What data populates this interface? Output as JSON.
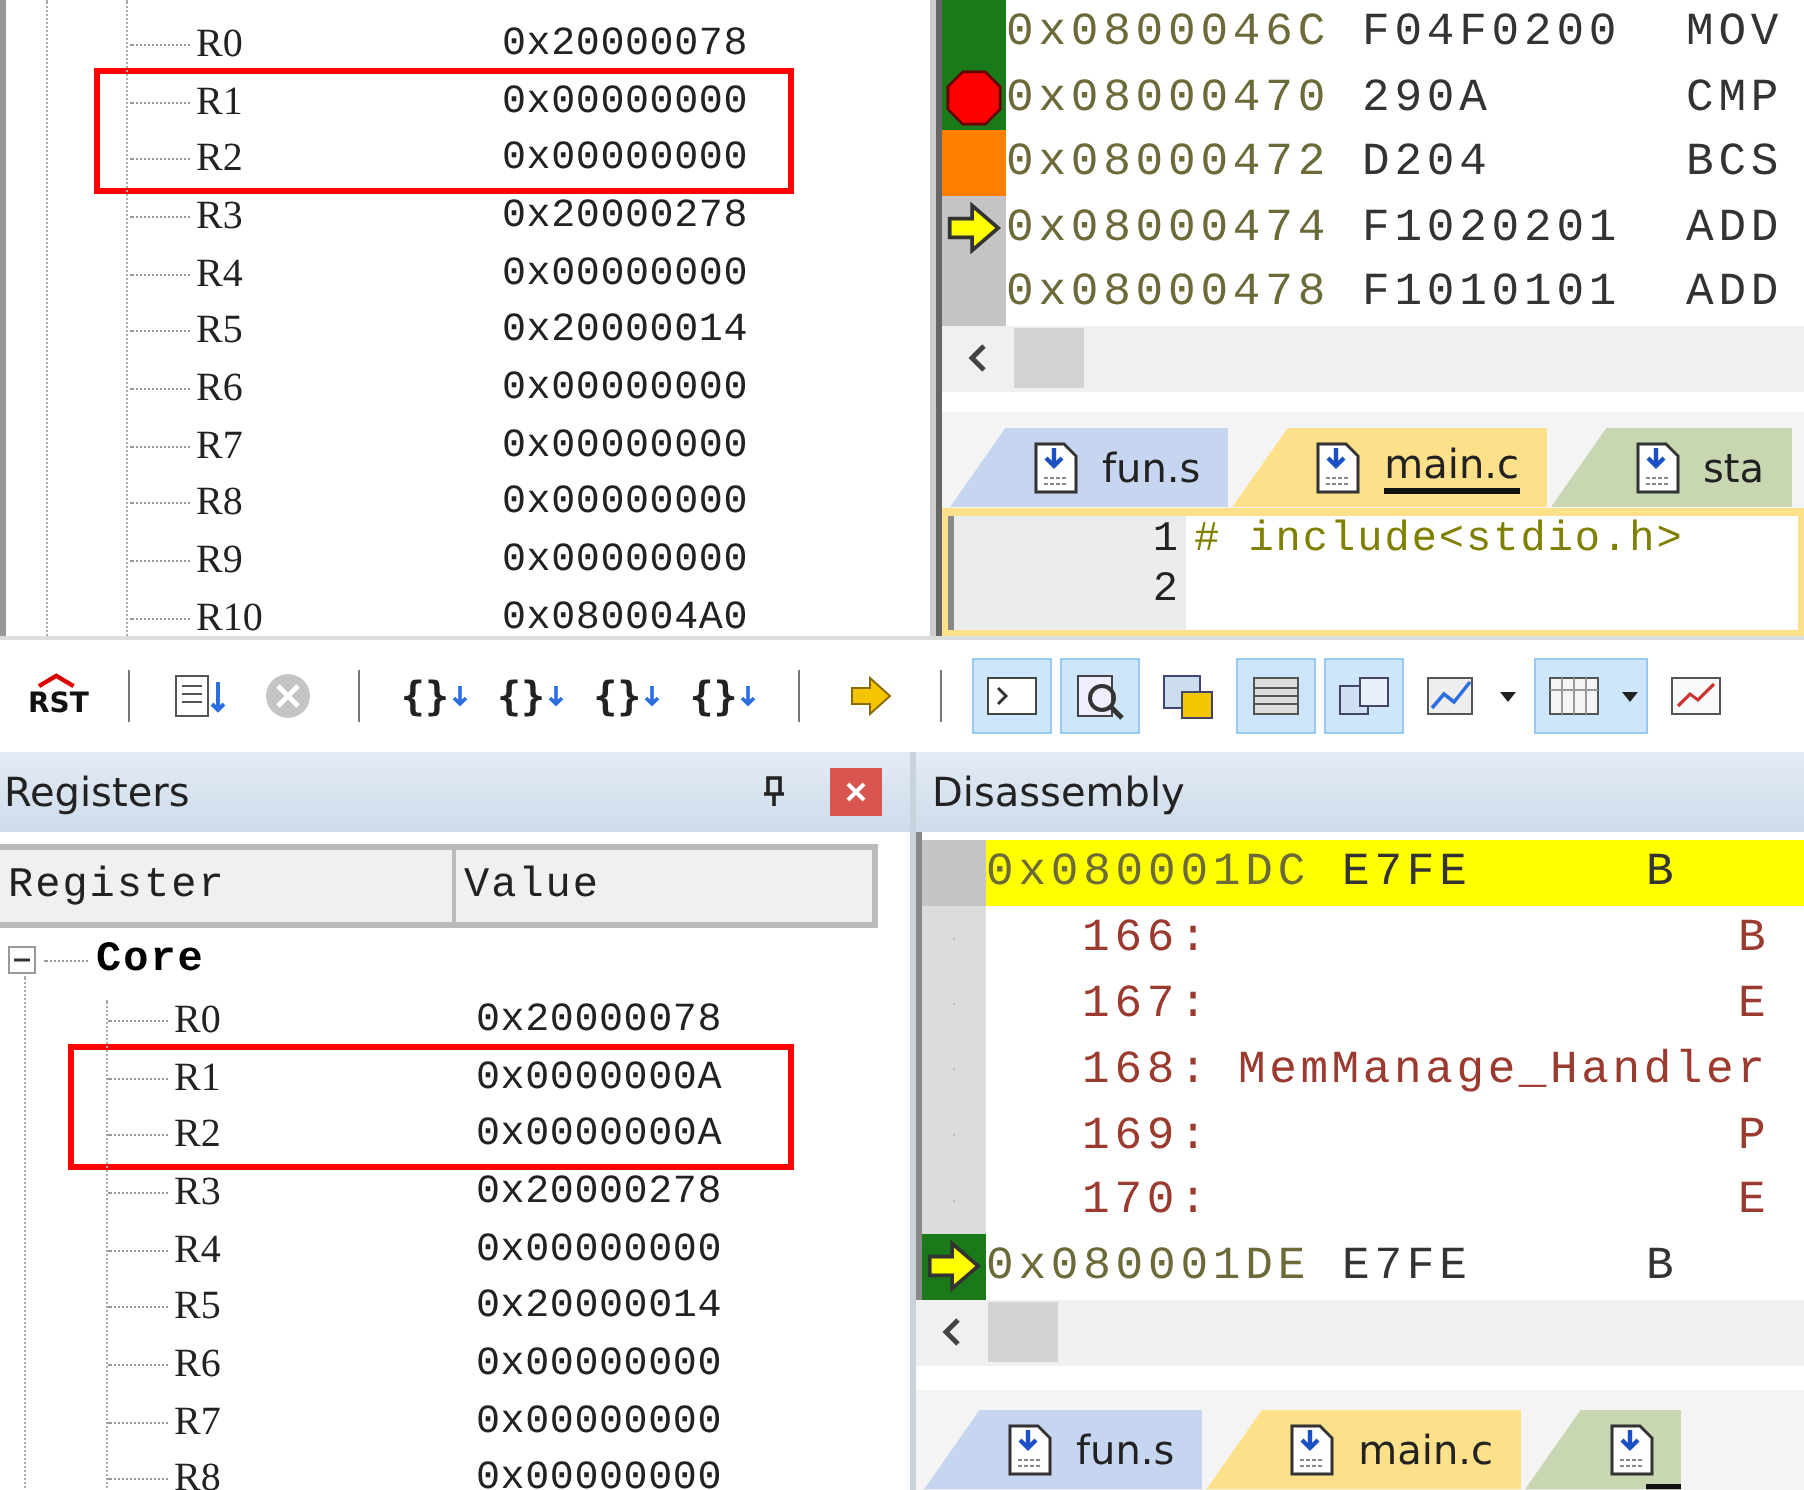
{
  "top": {
    "registers": [
      {
        "name": "R0",
        "value": "0x20000078",
        "highlighted": false
      },
      {
        "name": "R1",
        "value": "0x00000000",
        "highlighted": true
      },
      {
        "name": "R2",
        "value": "0x00000000",
        "highlighted": true
      },
      {
        "name": "R3",
        "value": "0x20000278",
        "highlighted": false
      },
      {
        "name": "R4",
        "value": "0x00000000",
        "highlighted": false
      },
      {
        "name": "R5",
        "value": "0x20000014",
        "highlighted": false
      },
      {
        "name": "R6",
        "value": "0x00000000",
        "highlighted": false
      },
      {
        "name": "R7",
        "value": "0x00000000",
        "highlighted": false
      },
      {
        "name": "R8",
        "value": "0x00000000",
        "highlighted": false
      },
      {
        "name": "R9",
        "value": "0x00000000",
        "highlighted": false
      },
      {
        "name": "R10",
        "value": "0x080004A0",
        "highlighted": false
      }
    ],
    "disassembly": [
      {
        "kind": "asm",
        "address": "0x0800046C",
        "opcode": "F04F0200",
        "mnemonic": "MOV",
        "color": "#1a7a1a",
        "breakpoint": false,
        "current": false
      },
      {
        "kind": "asm",
        "address": "0x08000470",
        "opcode": "290A",
        "mnemonic": "CMP",
        "color": "#1a7a1a",
        "breakpoint": true,
        "current": false
      },
      {
        "kind": "asm",
        "address": "0x08000472",
        "opcode": "D204",
        "mnemonic": "BCS",
        "color": "#ff8000",
        "breakpoint": false,
        "current": false
      },
      {
        "kind": "asm",
        "address": "0x08000474",
        "opcode": "F1020201",
        "mnemonic": "ADD",
        "color": "#c4c4c4",
        "breakpoint": false,
        "current": true
      },
      {
        "kind": "asm",
        "address": "0x08000478",
        "opcode": "F1010101",
        "mnemonic": "ADD",
        "color": "#c4c4c4",
        "breakpoint": false,
        "current": false
      }
    ],
    "tabs": [
      {
        "label": "fun.s",
        "color": "#c6d6f0",
        "selected": false
      },
      {
        "label": "main.c",
        "color": "#fce08a",
        "selected": true
      },
      {
        "label": "sta",
        "color": "#c9d6b2",
        "selected": false
      }
    ],
    "editor": [
      {
        "number": "1",
        "text": "# include<stdio.h>"
      },
      {
        "number": "2"
      }
    ]
  },
  "bottom": {
    "toolbar": [
      {
        "kind": "reset",
        "label": "RST"
      },
      {
        "kind": "separator"
      },
      {
        "kind": "list"
      },
      {
        "kind": "stop",
        "disabled": true
      },
      {
        "kind": "separator"
      },
      {
        "kind": "step-in",
        "label": "{}"
      },
      {
        "kind": "step-over",
        "label": "{}"
      },
      {
        "kind": "step-out",
        "label": "{}"
      },
      {
        "kind": "run-to",
        "label": "{}"
      },
      {
        "kind": "separator"
      },
      {
        "kind": "arrow"
      },
      {
        "kind": "separator"
      },
      {
        "kind": "command",
        "selected": true
      },
      {
        "kind": "disasm",
        "selected": true
      },
      {
        "kind": "symbols",
        "selected": false
      },
      {
        "kind": "registers",
        "selected": true
      },
      {
        "kind": "callstack",
        "selected": true
      },
      {
        "kind": "chart",
        "selected": false,
        "dropdown": true
      },
      {
        "kind": "memory",
        "selected": true,
        "dropdown": true
      },
      {
        "kind": "watch",
        "selected": false
      }
    ],
    "registers_panel": {
      "title": "Registers",
      "columns": [
        "Register",
        "Value"
      ],
      "group": "Core",
      "expanded": true,
      "rows": [
        {
          "name": "R0",
          "value": "0x20000078",
          "highlighted": false
        },
        {
          "name": "R1",
          "value": "0x0000000A",
          "highlighted": true
        },
        {
          "name": "R2",
          "value": "0x0000000A",
          "highlighted": true
        },
        {
          "name": "R3",
          "value": "0x20000278",
          "highlighted": false
        },
        {
          "name": "R4",
          "value": "0x00000000",
          "highlighted": false
        },
        {
          "name": "R5",
          "value": "0x20000014",
          "highlighted": false
        },
        {
          "name": "R6",
          "value": "0x00000000",
          "highlighted": false
        },
        {
          "name": "R7",
          "value": "0x00000000",
          "highlighted": false
        },
        {
          "name": "R8",
          "value": "0x00000000",
          "highlighted": false
        }
      ]
    },
    "disassembly_panel": {
      "title": "Disassembly",
      "lines": [
        {
          "kind": "asm",
          "address": "0x080001DC",
          "opcode": "E7FE",
          "mnemonic": "B",
          "color": "#c4c4c4",
          "highlighted": true,
          "current": false
        },
        {
          "kind": "source",
          "number": "166:",
          "text": "B",
          "color": "#dcdcdc"
        },
        {
          "kind": "source",
          "number": "167:",
          "text": "E",
          "color": "#dcdcdc"
        },
        {
          "kind": "source",
          "number": "168:",
          "text": "MemManage_Handler",
          "color": "#dcdcdc"
        },
        {
          "kind": "source",
          "number": "169:",
          "text": "P",
          "color": "#dcdcdc"
        },
        {
          "kind": "source",
          "number": "170:",
          "text": "E",
          "color": "#dcdcdc"
        },
        {
          "kind": "asm",
          "address": "0x080001DE",
          "opcode": "E7FE",
          "mnemonic": "B",
          "color": "#1a7a1a",
          "highlighted": false,
          "current": true
        }
      ]
    },
    "tabs": [
      {
        "label": "fun.s",
        "color": "#c6d6f0",
        "selected": false
      },
      {
        "label": "main.c",
        "color": "#fce08a",
        "selected": false
      },
      {
        "color": "#c9d6b2",
        "selected": true
      }
    ]
  }
}
